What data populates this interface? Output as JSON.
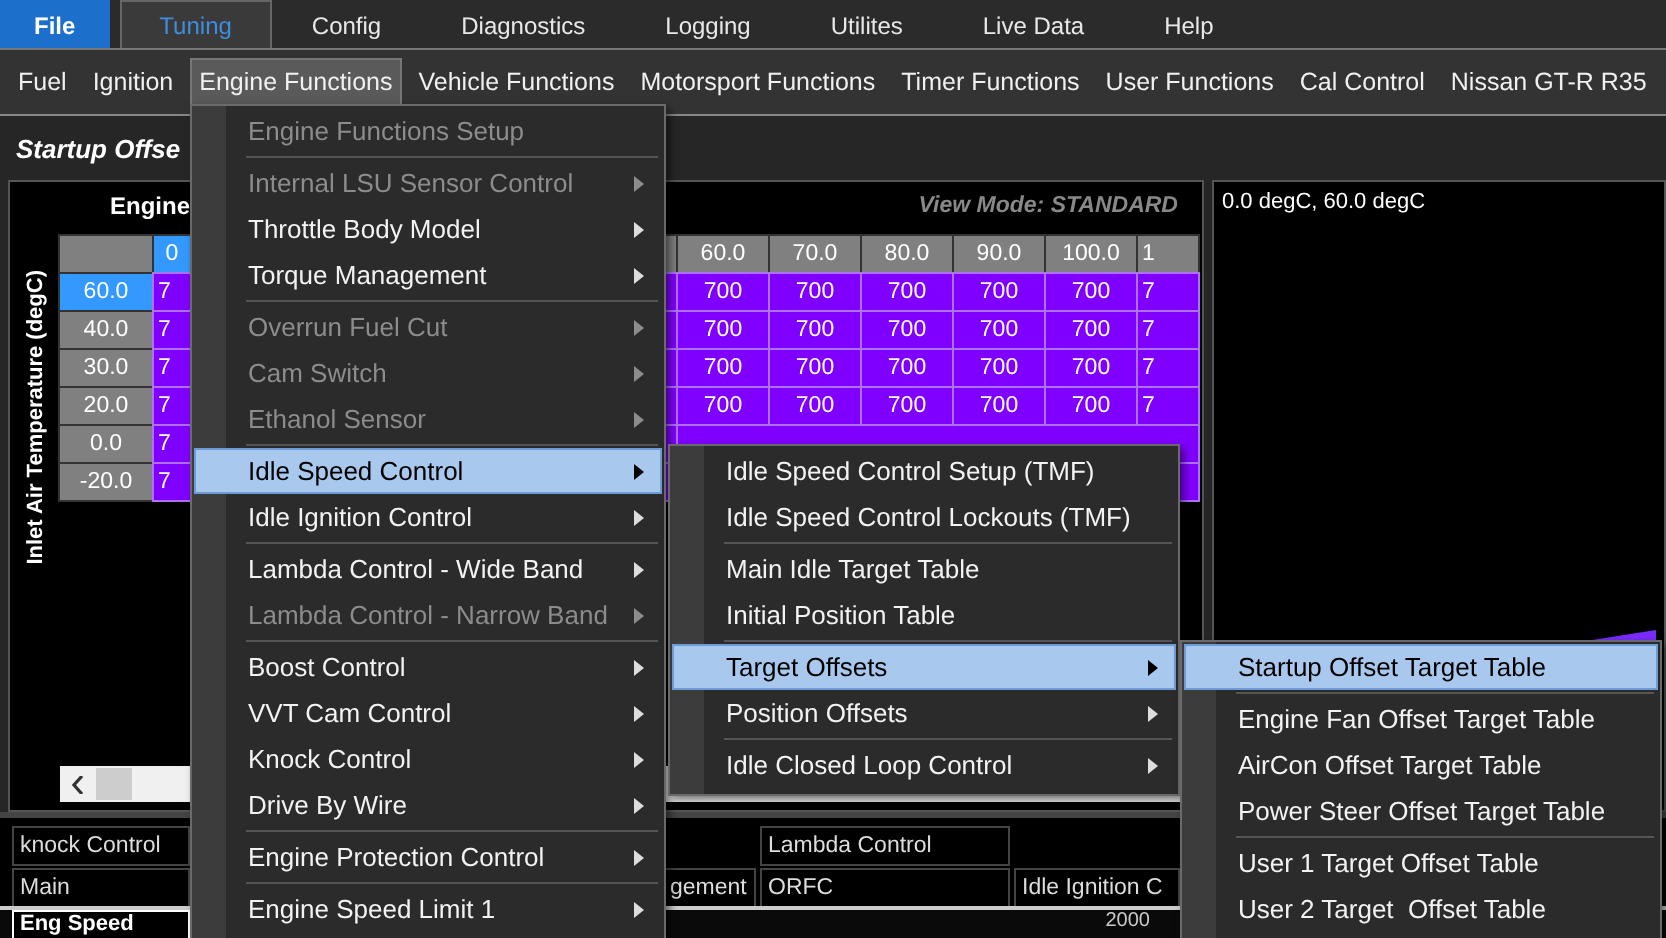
{
  "top_menu": [
    {
      "label": "File",
      "kind": "file",
      "selected": false
    },
    {
      "label": "Tuning",
      "kind": "tab",
      "selected": true
    },
    {
      "label": "Config",
      "kind": "tab",
      "selected": false
    },
    {
      "label": "Diagnostics",
      "kind": "tab",
      "selected": false
    },
    {
      "label": "Logging",
      "kind": "tab",
      "selected": false
    },
    {
      "label": "Utilites",
      "kind": "tab",
      "selected": false
    },
    {
      "label": "Live Data",
      "kind": "tab",
      "selected": false
    },
    {
      "label": "Help",
      "kind": "tab",
      "selected": false
    }
  ],
  "toolbar": [
    {
      "label": "Fuel",
      "selected": false
    },
    {
      "label": "Ignition",
      "selected": false
    },
    {
      "label": "Engine Functions",
      "selected": true
    },
    {
      "label": "Vehicle Functions",
      "selected": false
    },
    {
      "label": "Motorsport Functions",
      "selected": false
    },
    {
      "label": "Timer Functions",
      "selected": false
    },
    {
      "label": "User Functions",
      "selected": false
    },
    {
      "label": "Cal Control",
      "selected": false
    },
    {
      "label": "Nissan GT-R R35",
      "selected": false
    }
  ],
  "page_title": "Startup Offse",
  "table_panel": {
    "heading": "Engine",
    "view_mode": "View Mode: STANDARD",
    "y_axis_label": "Inlet Air Temperature (degC)",
    "columns": {
      "first": "0",
      "first_selected": true,
      "visible": [
        "60.0",
        "70.0",
        "80.0",
        "90.0",
        "100.0"
      ],
      "last": "1"
    },
    "rows": [
      {
        "label": "60.0",
        "selected": true,
        "first": "7",
        "values": [
          "700",
          "700",
          "700",
          "700",
          "700"
        ],
        "last": "7"
      },
      {
        "label": "40.0",
        "selected": false,
        "first": "7",
        "values": [
          "700",
          "700",
          "700",
          "700",
          "700"
        ],
        "last": "7"
      },
      {
        "label": "30.0",
        "selected": false,
        "first": "7",
        "values": [
          "700",
          "700",
          "700",
          "700",
          "700"
        ],
        "last": "7"
      },
      {
        "label": "20.0",
        "selected": false,
        "first": "7",
        "values": [
          "700",
          "700",
          "700",
          "700",
          "700"
        ],
        "last": "7"
      },
      {
        "label": "0.0",
        "selected": false,
        "first": "7",
        "values": []
      },
      {
        "label": "-20.0",
        "selected": false,
        "first": "7",
        "values": []
      }
    ]
  },
  "graph_panel": {
    "caption": "0.0 degC, 60.0 degC"
  },
  "bottom_tabs": [
    [
      {
        "kind": "tab",
        "label": "knock Control"
      },
      {
        "kind": "blank"
      },
      {
        "kind": "blank"
      },
      {
        "kind": "tab",
        "label": "Lambda Control"
      },
      {
        "kind": "blank"
      }
    ],
    [
      {
        "kind": "tab",
        "label": "Main"
      },
      {
        "kind": "blank"
      },
      {
        "kind": "tab",
        "label": "gement"
      },
      {
        "kind": "tab",
        "label": "ORFC"
      },
      {
        "kind": "tab",
        "label": "Idle Ignition C"
      }
    ]
  ],
  "chart_strip": {
    "label": "Eng Speed",
    "tick": "2000"
  },
  "engine_functions_menu": [
    {
      "kind": "item",
      "label": "Engine Functions Setup",
      "disabled": true,
      "selected": false,
      "submenu": false
    },
    {
      "kind": "separator"
    },
    {
      "kind": "item",
      "label": "Internal LSU Sensor Control",
      "disabled": true,
      "selected": false,
      "submenu": true
    },
    {
      "kind": "item",
      "label": "Throttle Body Model",
      "disabled": false,
      "selected": false,
      "submenu": true
    },
    {
      "kind": "item",
      "label": "Torque Management",
      "disabled": false,
      "selected": false,
      "submenu": true
    },
    {
      "kind": "separator"
    },
    {
      "kind": "item",
      "label": "Overrun Fuel Cut",
      "disabled": true,
      "selected": false,
      "submenu": true
    },
    {
      "kind": "item",
      "label": "Cam Switch",
      "disabled": true,
      "selected": false,
      "submenu": true
    },
    {
      "kind": "item",
      "label": "Ethanol Sensor",
      "disabled": true,
      "selected": false,
      "submenu": true
    },
    {
      "kind": "separator"
    },
    {
      "kind": "item",
      "label": "Idle Speed Control",
      "disabled": false,
      "selected": true,
      "submenu": true
    },
    {
      "kind": "item",
      "label": "Idle Ignition Control",
      "disabled": false,
      "selected": false,
      "submenu": true
    },
    {
      "kind": "separator"
    },
    {
      "kind": "item",
      "label": "Lambda Control - Wide Band",
      "disabled": false,
      "selected": false,
      "submenu": true
    },
    {
      "kind": "item",
      "label": "Lambda Control - Narrow Band",
      "disabled": true,
      "selected": false,
      "submenu": true
    },
    {
      "kind": "separator"
    },
    {
      "kind": "item",
      "label": "Boost Control",
      "disabled": false,
      "selected": false,
      "submenu": true
    },
    {
      "kind": "item",
      "label": "VVT Cam Control",
      "disabled": false,
      "selected": false,
      "submenu": true
    },
    {
      "kind": "item",
      "label": "Knock Control",
      "disabled": false,
      "selected": false,
      "submenu": true
    },
    {
      "kind": "item",
      "label": "Drive By Wire",
      "disabled": false,
      "selected": false,
      "submenu": true
    },
    {
      "kind": "separator"
    },
    {
      "kind": "item",
      "label": "Engine Protection Control",
      "disabled": false,
      "selected": false,
      "submenu": true
    },
    {
      "kind": "separator"
    },
    {
      "kind": "item",
      "label": "Engine Speed Limit 1",
      "disabled": false,
      "selected": false,
      "submenu": true
    }
  ],
  "idle_speed_menu": [
    {
      "kind": "item",
      "label": "Idle Speed Control Setup (TMF)",
      "disabled": false,
      "selected": false,
      "submenu": false
    },
    {
      "kind": "item",
      "label": "Idle Speed Control Lockouts (TMF)",
      "disabled": false,
      "selected": false,
      "submenu": false
    },
    {
      "kind": "separator"
    },
    {
      "kind": "item",
      "label": "Main Idle Target Table",
      "disabled": false,
      "selected": false,
      "submenu": false
    },
    {
      "kind": "item",
      "label": "Initial Position Table",
      "disabled": false,
      "selected": false,
      "submenu": false
    },
    {
      "kind": "separator"
    },
    {
      "kind": "item",
      "label": "Target Offsets",
      "disabled": false,
      "selected": true,
      "submenu": true
    },
    {
      "kind": "item",
      "label": "Position Offsets",
      "disabled": false,
      "selected": false,
      "submenu": true
    },
    {
      "kind": "separator"
    },
    {
      "kind": "item",
      "label": "Idle Closed Loop Control",
      "disabled": false,
      "selected": false,
      "submenu": true
    }
  ],
  "target_offsets_menu": [
    {
      "kind": "item",
      "label": "Startup Offset Target Table",
      "disabled": false,
      "selected": true,
      "submenu": false
    },
    {
      "kind": "separator"
    },
    {
      "kind": "item",
      "label": "Engine Fan Offset Target Table",
      "disabled": false,
      "selected": false,
      "submenu": false
    },
    {
      "kind": "item",
      "label": "AirCon Offset Target Table",
      "disabled": false,
      "selected": false,
      "submenu": false
    },
    {
      "kind": "item",
      "label": "Power Steer Offset Target Table",
      "disabled": false,
      "selected": false,
      "submenu": false
    },
    {
      "kind": "separator"
    },
    {
      "kind": "item",
      "label": "User 1 Target Offset Table",
      "disabled": false,
      "selected": false,
      "submenu": false
    },
    {
      "kind": "item",
      "label": "User 2 Target  Offset Table",
      "disabled": false,
      "selected": false,
      "submenu": false
    }
  ]
}
